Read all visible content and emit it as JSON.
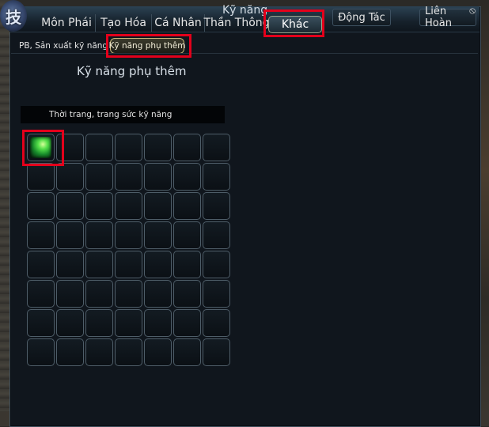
{
  "window": {
    "title": "Kỹ năng",
    "emblem_glyph": "技"
  },
  "tabs": [
    {
      "label": "Môn Phái"
    },
    {
      "label": "Tạo Hóa"
    },
    {
      "label": "Cá Nhân"
    },
    {
      "label": "Thần Thông"
    },
    {
      "label": "Khác",
      "active": true
    }
  ],
  "top_buttons": {
    "dong_tac": "Động Tác",
    "lien_hoan": "Liên Hoàn",
    "close": "⦸"
  },
  "subtabs": [
    {
      "label": "PB, Sản xuất kỹ năng"
    },
    {
      "label": "Kỹ năng phụ thêm",
      "active": true
    }
  ],
  "section": {
    "title": "Kỹ năng phụ thêm"
  },
  "group": {
    "header": "Thời trang, trang sức kỹ năng"
  },
  "grid": {
    "rows": 8,
    "cols": 7,
    "filled": [
      {
        "index": 0,
        "icon": "green-jade-skill-icon"
      }
    ]
  },
  "colors": {
    "highlight": "#e3001b",
    "window_bg": "#10161d",
    "active_tab_border": "#9aa48c"
  }
}
